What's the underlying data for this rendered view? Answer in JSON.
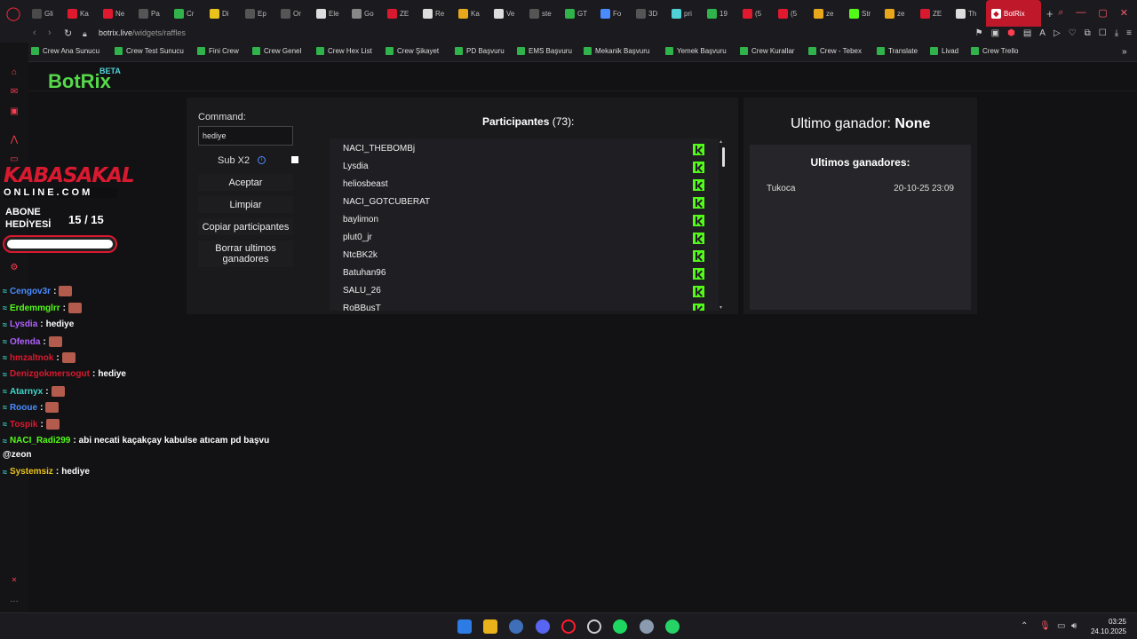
{
  "browser": {
    "tabs": [
      {
        "label": "Gli",
        "color": "#4a4a4a"
      },
      {
        "label": "Ka",
        "color": "#e0192f"
      },
      {
        "label": "Ne",
        "color": "#e0192f"
      },
      {
        "label": "Pa",
        "color": "#555"
      },
      {
        "label": "Cr",
        "color": "#2fb34a"
      },
      {
        "label": "Di",
        "color": "#e9c31b"
      },
      {
        "label": "Ep",
        "color": "#555"
      },
      {
        "label": "Or",
        "color": "#555"
      },
      {
        "label": "Ele",
        "color": "#ddd"
      },
      {
        "label": "Go",
        "color": "#888"
      },
      {
        "label": "ZE",
        "color": "#d9192f"
      },
      {
        "label": "Re",
        "color": "#ddd"
      },
      {
        "label": "Ka",
        "color": "#e9a81b"
      },
      {
        "label": "Ve",
        "color": "#ddd"
      },
      {
        "label": "ste",
        "color": "#555"
      },
      {
        "label": "GT",
        "color": "#2fb34a"
      },
      {
        "label": "Fo",
        "color": "#4a8cff"
      },
      {
        "label": "3D",
        "color": "#555"
      },
      {
        "label": "pri",
        "color": "#4fd3d9"
      },
      {
        "label": "19",
        "color": "#2fb34a"
      },
      {
        "label": "(5",
        "color": "#e0192f"
      },
      {
        "label": "(5",
        "color": "#e0192f"
      },
      {
        "label": "ze",
        "color": "#e9a81b"
      },
      {
        "label": "Str",
        "color": "#53fc18"
      },
      {
        "label": "ze",
        "color": "#e9a81b"
      },
      {
        "label": "ZE",
        "color": "#d9192f"
      },
      {
        "label": "Th",
        "color": "#ddd"
      }
    ],
    "active_tab": "BotRix",
    "url_host": "botrix.live",
    "url_path": "/widgets/raffles",
    "bookmarks": [
      "Crew Ana Sunucu",
      "Crew Test Sunucu",
      "Fini Crew",
      "Crew Genel",
      "Crew Hex List",
      "Crew Şikayet",
      "PD Başvuru",
      "EMS Başvuru",
      "Mekanik Başvuru",
      "Yemek Başvuru",
      "Crew Kurallar",
      "Crew - Tebex",
      "Translate",
      "Livad",
      "Crew Trello"
    ]
  },
  "app": {
    "brand": "BotRix",
    "beta": "BETA",
    "command_label": "Command:",
    "command_value": "hediye",
    "sub_label": "Sub X2",
    "buttons": {
      "accept": "Aceptar",
      "clear": "Limpiar",
      "copy": "Copiar participantes",
      "delete_l1": "Borrar ultimos",
      "delete_l2": "ganadores"
    },
    "participants_title": "Participantes",
    "participants_count": "(73):",
    "participants": [
      "NACI_THEBOMBj",
      "Lysdia",
      "heliosbeast",
      "NACI_GOTCUBERAT",
      "baylimon",
      "plut0_jr",
      "NtcBK2k",
      "Batuhan96",
      "SALU_26",
      "RoBBusT"
    ],
    "last_winner_label": "Ultimo ganador:",
    "last_winner_value": "None",
    "winners_title": "Ultimos ganadores:",
    "winners": [
      {
        "name": "Tukoca",
        "date": "20-10-25 23:09"
      }
    ]
  },
  "overlay": {
    "logo_top": "KABASAKAL",
    "logo_bottom": "ONLINE.COM",
    "sub_line1": "ABONE",
    "sub_line2": "HEDİYESİ",
    "sub_count": "15  / 15",
    "sub_progress": 1.0,
    "chat": [
      {
        "user": "Cengov3r",
        "sep": " :",
        "msg": "",
        "color": "#4a8cff",
        "emote": true
      },
      {
        "user": "Erdemmglrr",
        "sep": " :",
        "msg": "",
        "color": "#53fc18",
        "emote": true
      },
      {
        "user": "Lysdia",
        "sep": " :",
        "msg": "hediye",
        "color": "#b060ff",
        "emote": false
      },
      {
        "user": "Ofenda",
        "sep": " :",
        "msg": "",
        "color": "#b060ff",
        "emote": true
      },
      {
        "user": "hmzaltnok",
        "sep": " :",
        "msg": "",
        "color": "#d9192f",
        "emote": true
      },
      {
        "user": "Denizgokmersogut",
        "sep": " :",
        "msg": "hediye",
        "color": "#d9192f",
        "emote": false
      },
      {
        "user": "Atarnyx",
        "sep": " :",
        "msg": "",
        "color": "#3fd6c9",
        "emote": true
      },
      {
        "user": "Rooue",
        "sep": " :",
        "msg": "",
        "color": "#4a8cff",
        "emote": true
      },
      {
        "user": "Tospik",
        "sep": " :",
        "msg": "",
        "color": "#d9192f",
        "emote": true
      },
      {
        "user": "NACI_Radi299",
        "sep": " :",
        "msg": "abi necati kaçakçay kabulse atıcam pd başvu",
        "color": "#53fc18",
        "emote": false
      },
      {
        "user": "Systemsiz",
        "sep": " :",
        "msg": "hediye",
        "color": "#e9c31b",
        "emote": false
      }
    ],
    "chat_wrap": "@zeon"
  },
  "taskbar": {
    "time": "03:25",
    "date": "24.10.2025"
  }
}
